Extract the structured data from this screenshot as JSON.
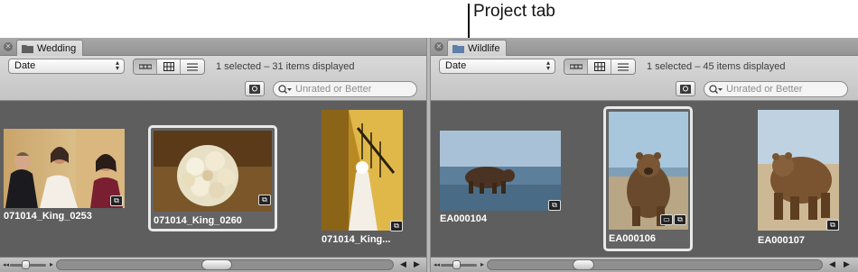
{
  "annotation": {
    "label": "Project tab"
  },
  "panes": [
    {
      "tab": {
        "label": "Wedding"
      },
      "sort": {
        "value": "Date"
      },
      "status": "1 selected – 31 items displayed",
      "filter": {
        "placeholder": "Unrated or Better"
      },
      "thumbnails": [
        {
          "caption": "071014_King_0253",
          "selected": false
        },
        {
          "caption": "071014_King_0260",
          "selected": true
        },
        {
          "caption": "071014_King...",
          "selected": false
        }
      ]
    },
    {
      "tab": {
        "label": "Wildlife"
      },
      "sort": {
        "value": "Date"
      },
      "status": "1 selected – 45 items displayed",
      "filter": {
        "placeholder": "Unrated or Better"
      },
      "thumbnails": [
        {
          "caption": "EA000104",
          "selected": false
        },
        {
          "caption": "EA000106",
          "selected": true
        },
        {
          "caption": "EA000107",
          "selected": false
        }
      ]
    }
  ],
  "icons": {
    "close": "close-icon",
    "folder": "folder-icon",
    "filmstrip_view": "filmstrip-view-icon",
    "grid_view": "grid-view-icon",
    "list_view": "list-view-icon",
    "search": "search-icon",
    "badge": "adjustment-badge-icon"
  },
  "colors": {
    "pane_background": "#5e5e5e",
    "toolbar_background": "#d0d0d0",
    "caption_text": "#ffffff",
    "selection_border": "#e9e9e9"
  }
}
